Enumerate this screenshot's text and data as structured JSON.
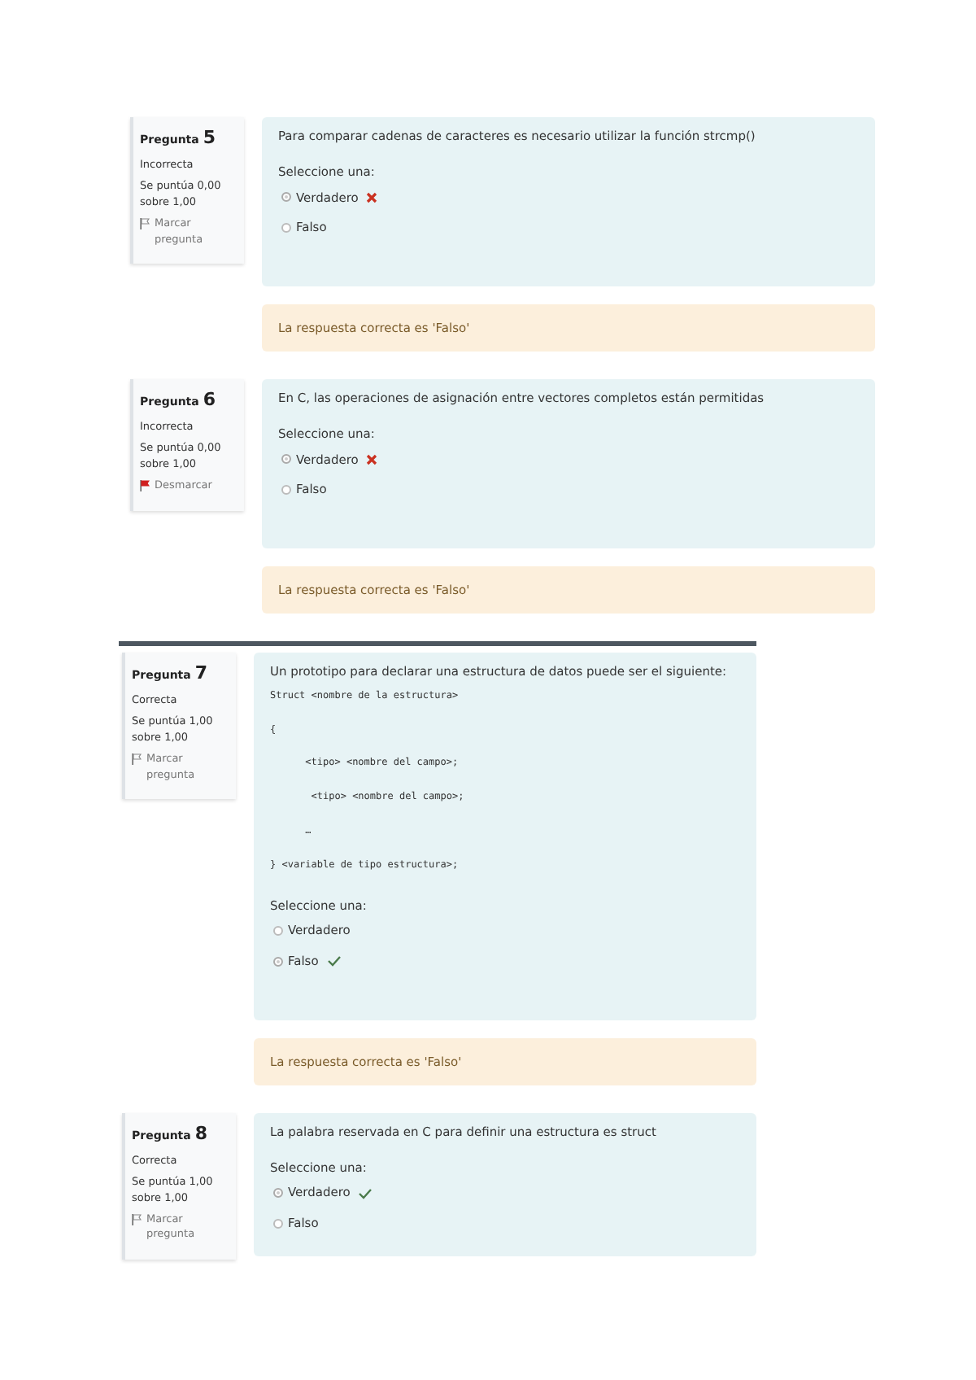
{
  "pages": [
    {
      "questions": [
        {
          "number_label": "Pregunta",
          "number": "5",
          "status": "Incorrecta",
          "score": "Se puntúa 0,00 sobre 1,00",
          "flag_label": "Marcar pregunta",
          "flagged": false,
          "prompt": "Para comparar cadenas de caracteres es necesario utilizar la función strcmp()",
          "instruction": "Seleccione una:",
          "options": [
            {
              "label": "Verdadero",
              "selected": true,
              "marked_wrong": true,
              "marked_right": false
            },
            {
              "label": "Falso",
              "selected": false,
              "marked_wrong": false,
              "marked_right": false
            }
          ],
          "feedback": "La respuesta correcta es 'Falso'"
        },
        {
          "number_label": "Pregunta",
          "number": "6",
          "status": "Incorrecta",
          "score": "Se puntúa 0,00 sobre 1,00",
          "flag_label": "Desmarcar",
          "flagged": true,
          "prompt": "En C, las operaciones de asignación entre vectores completos están permitidas",
          "instruction": "Seleccione una:",
          "options": [
            {
              "label": "Verdadero",
              "selected": true,
              "marked_wrong": true,
              "marked_right": false
            },
            {
              "label": "Falso",
              "selected": false,
              "marked_wrong": false,
              "marked_right": false
            }
          ],
          "feedback": "La respuesta correcta es 'Falso'"
        }
      ]
    },
    {
      "questions": [
        {
          "number_label": "Pregunta",
          "number": "7",
          "status": "Correcta",
          "score": "Se puntúa 1,00 sobre 1,00",
          "flag_label": "Marcar pregunta",
          "flagged": false,
          "prompt": "Un prototipo para declarar una estructura de datos puede ser el siguiente:",
          "code": [
            "Struct <nombre de la estructura>",
            "{",
            "      <tipo> <nombre del campo>;",
            "       <tipo> <nombre del campo>;",
            "      …",
            "} <variable de tipo estructura>;"
          ],
          "instruction": "Seleccione una:",
          "options": [
            {
              "label": "Verdadero",
              "selected": false,
              "marked_wrong": false,
              "marked_right": false
            },
            {
              "label": "Falso",
              "selected": true,
              "marked_wrong": false,
              "marked_right": true
            }
          ],
          "feedback": "La respuesta correcta es 'Falso'"
        },
        {
          "number_label": "Pregunta",
          "number": "8",
          "status": "Correcta",
          "score": "Se puntúa 1,00 sobre 1,00",
          "flag_label": "Marcar pregunta",
          "flagged": false,
          "prompt": "La palabra reservada en C para definir una estructura es struct",
          "instruction": "Seleccione una:",
          "options": [
            {
              "label": "Verdadero",
              "selected": true,
              "marked_wrong": false,
              "marked_right": true
            },
            {
              "label": "Falso",
              "selected": false,
              "marked_wrong": false,
              "marked_right": false
            }
          ]
        }
      ]
    }
  ]
}
